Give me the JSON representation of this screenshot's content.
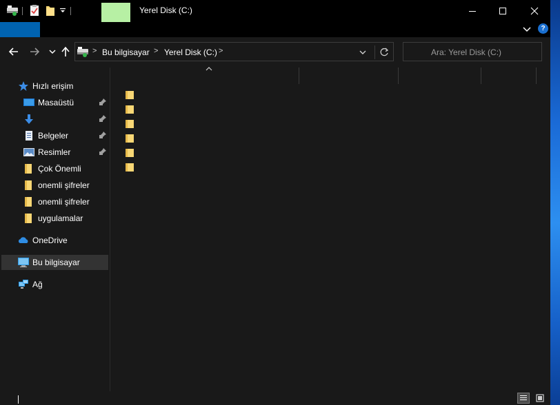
{
  "window": {
    "title": "Yerel Disk (C:)",
    "accent_color": "#b7f0a4",
    "file_tab_color": "#0063b1"
  },
  "ribbon": {
    "help_glyph": "?"
  },
  "address": {
    "crumbs": [
      "Bu bilgisayar",
      "Yerel Disk (C:)"
    ],
    "separator": ">"
  },
  "search": {
    "placeholder": "Ara: Yerel Disk (C:)"
  },
  "navpane": {
    "items": [
      {
        "label": "Hızlı erişim",
        "icon": "star-icon",
        "pinned": false
      },
      {
        "label": "Masaüstü",
        "icon": "desktop-icon",
        "pinned": true
      },
      {
        "label": "",
        "icon": "downloads-icon",
        "pinned": true
      },
      {
        "label": "Belgeler",
        "icon": "documents-icon",
        "pinned": true
      },
      {
        "label": "Resimler",
        "icon": "pictures-icon",
        "pinned": true
      },
      {
        "label": "Çok Önemli",
        "icon": "folder-icon",
        "pinned": false
      },
      {
        "label": "onemli şifreler",
        "icon": "folder-icon",
        "pinned": false
      },
      {
        "label": "onemli şifreler",
        "icon": "folder-icon",
        "pinned": false
      },
      {
        "label": "uygulamalar",
        "icon": "folder-icon",
        "pinned": false
      },
      {
        "label": "OneDrive",
        "icon": "onedrive-icon",
        "pinned": false
      },
      {
        "label": "Bu bilgisayar",
        "icon": "this-pc-icon",
        "pinned": false,
        "selected": true
      },
      {
        "label": "Ağ",
        "icon": "network-icon",
        "pinned": false
      }
    ]
  },
  "content": {
    "file_rows": 6
  },
  "status": {
    "text": ""
  }
}
